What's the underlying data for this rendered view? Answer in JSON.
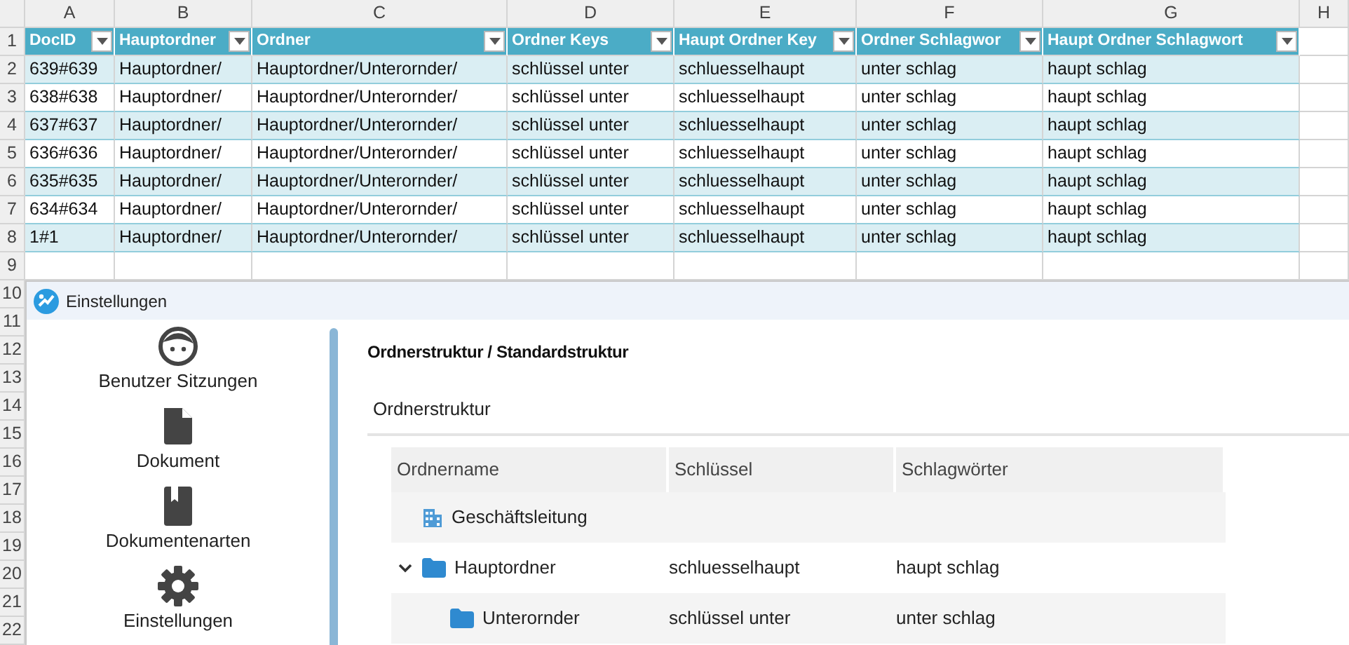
{
  "sheet": {
    "column_letters": [
      "A",
      "B",
      "C",
      "D",
      "E",
      "F",
      "G",
      "H"
    ],
    "headers": [
      "DocID",
      "Hauptordner",
      "Ordner",
      "Ordner Keys",
      "Haupt Ordner Key",
      "Ordner Schlagwor",
      "Haupt Ordner Schlagwort"
    ],
    "rows": [
      [
        "639#639",
        "Hauptordner/",
        "Hauptordner/Unterornder/",
        "schlüssel unter",
        "schluesselhaupt",
        "unter schlag",
        "haupt schlag"
      ],
      [
        "638#638",
        "Hauptordner/",
        "Hauptordner/Unterornder/",
        "schlüssel unter",
        "schluesselhaupt",
        "unter schlag",
        "haupt schlag"
      ],
      [
        "637#637",
        "Hauptordner/",
        "Hauptordner/Unterornder/",
        "schlüssel unter",
        "schluesselhaupt",
        "unter schlag",
        "haupt schlag"
      ],
      [
        "636#636",
        "Hauptordner/",
        "Hauptordner/Unterornder/",
        "schlüssel unter",
        "schluesselhaupt",
        "unter schlag",
        "haupt schlag"
      ],
      [
        "635#635",
        "Hauptordner/",
        "Hauptordner/Unterornder/",
        "schlüssel unter",
        "schluesselhaupt",
        "unter schlag",
        "haupt schlag"
      ],
      [
        "634#634",
        "Hauptordner/",
        "Hauptordner/Unterornder/",
        "schlüssel unter",
        "schluesselhaupt",
        "unter schlag",
        "haupt schlag"
      ],
      [
        "1#1",
        "Hauptordner/",
        "Hauptordner/Unterornder/",
        "schlüssel unter",
        "schluesselhaupt",
        "unter schlag",
        "haupt schlag"
      ]
    ],
    "row_numbers": [
      "1",
      "2",
      "3",
      "4",
      "5",
      "6",
      "7",
      "8",
      "9",
      "10",
      "11",
      "12",
      "13",
      "14",
      "15",
      "16",
      "17",
      "18",
      "19",
      "20",
      "21",
      "22"
    ]
  },
  "dialog": {
    "title": "Einstellungen",
    "sidebar": {
      "items": [
        {
          "label": "Benutzer Sitzungen",
          "kind": "face"
        },
        {
          "label": "Dokument",
          "kind": "file"
        },
        {
          "label": "Dokumentenarten",
          "kind": "bookmark"
        },
        {
          "label": "Einstellungen",
          "kind": "gear"
        }
      ]
    },
    "heading": "Ordnerstruktur / Standardstruktur",
    "tab": "Ordnerstruktur",
    "tree": {
      "columns": [
        "Ordnername",
        "Schlüssel",
        "Schlagwörter"
      ],
      "rows": [
        {
          "name": "Geschäftsleitung",
          "kind": "building"
        },
        {
          "name": "Hauptordner",
          "kind": "folder",
          "key": "schluesselhaupt",
          "keywords": "haupt schlag",
          "expanded": true,
          "children": [
            {
              "name": "Unterornder",
              "kind": "folder",
              "key": "schlüssel unter",
              "keywords": "unter schlag"
            }
          ]
        }
      ]
    }
  }
}
